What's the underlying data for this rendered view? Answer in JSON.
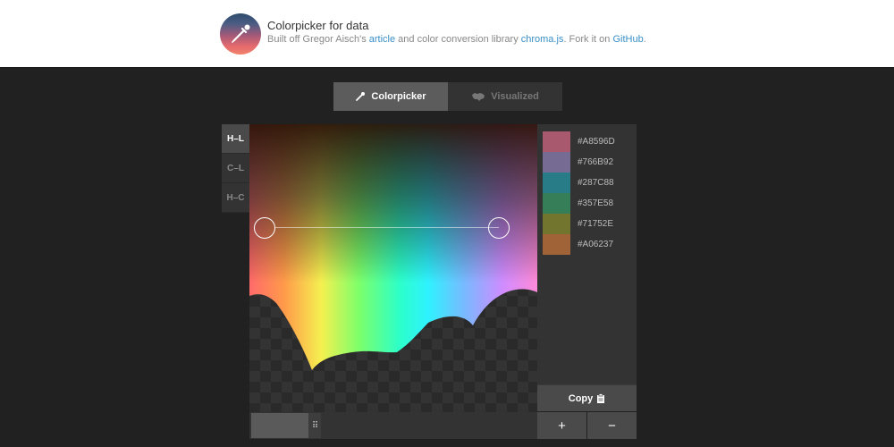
{
  "header": {
    "title": "Colorpicker for data",
    "subtitle_prefix": "Built off Gregor Aisch's ",
    "link_article": "article",
    "subtitle_mid": " and color conversion library ",
    "link_chroma": "chroma.js",
    "subtitle_mid2": ". Fork it on ",
    "link_github": "GitHub",
    "subtitle_end": "."
  },
  "tabs": [
    {
      "label": "Colorpicker",
      "icon": "eyedropper-icon",
      "active": true
    },
    {
      "label": "Visualized",
      "icon": "map-icon",
      "active": false
    }
  ],
  "modes": [
    {
      "label": "H–L",
      "active": true
    },
    {
      "label": "C–L",
      "active": false
    },
    {
      "label": "H–C",
      "active": false
    }
  ],
  "swatches": [
    {
      "hex": "#A8596D",
      "label": "#A8596D"
    },
    {
      "hex": "#766B92",
      "label": "#766B92"
    },
    {
      "hex": "#287C88",
      "label": "#287C88"
    },
    {
      "hex": "#357E58",
      "label": "#357E58"
    },
    {
      "hex": "#71752E",
      "label": "#71752E"
    },
    {
      "hex": "#A06237",
      "label": "#A06237"
    }
  ],
  "actions": {
    "copy_label": "Copy",
    "plus_label": "+",
    "minus_label": "−"
  },
  "slider": {
    "grip_symbol": "⠿"
  },
  "colors": {
    "background": "#212121",
    "link": "#3a8fc7",
    "active_tab": "#5c5c5c"
  }
}
